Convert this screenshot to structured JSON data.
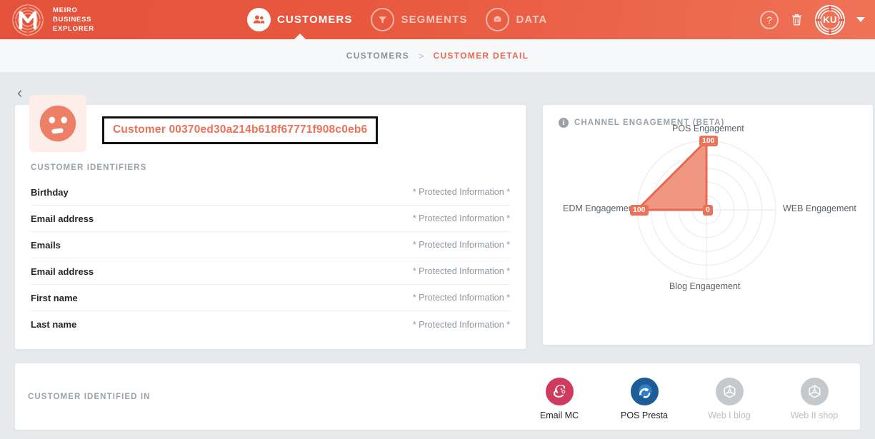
{
  "brand": {
    "logo_icon": "meiro-maze-m-logo",
    "line1": "MEIRO",
    "line2": "BUSINESS",
    "line3": "EXPLORER"
  },
  "nav": {
    "items": [
      {
        "label": "CUSTOMERS",
        "icon": "people-icon",
        "active": true
      },
      {
        "label": "SEGMENTS",
        "icon": "funnel-icon",
        "active": false
      },
      {
        "label": "DATA",
        "icon": "gauge-icon",
        "active": false
      }
    ]
  },
  "header_right": {
    "help_label": "?",
    "help_icon": "question-mark-icon",
    "trash_icon": "trash-icon",
    "avatar_initials": "KU",
    "avatar_icon": "user-avatar-maze-badge",
    "dropdown_icon": "chevron-down-icon"
  },
  "breadcrumb": {
    "parent": "CUSTOMERS",
    "separator": ">",
    "current": "CUSTOMER DETAIL"
  },
  "back_button": {
    "icon": "chevron-left-icon",
    "glyph": "‹"
  },
  "customer": {
    "avatar_icon": "customer-face-avatar",
    "id_label": "Customer 00370ed30a214b618f67771f908c0eb6",
    "identifiers_title": "CUSTOMER IDENTIFIERS",
    "identifiers": [
      {
        "key": "Birthday",
        "value": "* Protected Information *"
      },
      {
        "key": "Email address",
        "value": "* Protected Information *"
      },
      {
        "key": "Emails",
        "value": "* Protected Information *"
      },
      {
        "key": "Email address",
        "value": "* Protected Information *"
      },
      {
        "key": "First name",
        "value": "* Protected Information *"
      },
      {
        "key": "Last name",
        "value": "* Protected Information *"
      }
    ]
  },
  "engagement_panel": {
    "title": "CHANNEL ENGAGEMENT (BETA)",
    "info_icon": "info-icon",
    "info_glyph": "i"
  },
  "chart_data": {
    "type": "radar",
    "title": "CHANNEL ENGAGEMENT (BETA)",
    "categories": [
      "POS Engagement",
      "WEB Engagement",
      "Blog Engagement",
      "EDM Engagement"
    ],
    "values": [
      100,
      0,
      0,
      100
    ],
    "value_labels": [
      "100",
      "0",
      "",
      "100"
    ],
    "rlim": [
      0,
      100
    ],
    "grid_rings": 5,
    "grid": true,
    "legend": "none",
    "fill_color": "#f0907a",
    "line_color": "#e8694f",
    "axis_label_color": "#5a6169"
  },
  "identified_in": {
    "title": "CUSTOMER IDENTIFIED IN",
    "sources": [
      {
        "label": "Email MC",
        "icon": "mailchimp-icon",
        "active": true,
        "color": "#cf3a5e"
      },
      {
        "label": "POS Presta",
        "icon": "prestashop-icon",
        "active": true,
        "color": "#1d5c96"
      },
      {
        "label": "Web I blog",
        "icon": "cube-icon",
        "active": false,
        "color": "#c4c9cd"
      },
      {
        "label": "Web II shop",
        "icon": "cube-icon",
        "active": false,
        "color": "#c4c9cd"
      }
    ]
  },
  "theme": {
    "brand_orange": "#e8573f",
    "accent_coral": "#ea7259",
    "page_bg": "#e6eaec"
  }
}
